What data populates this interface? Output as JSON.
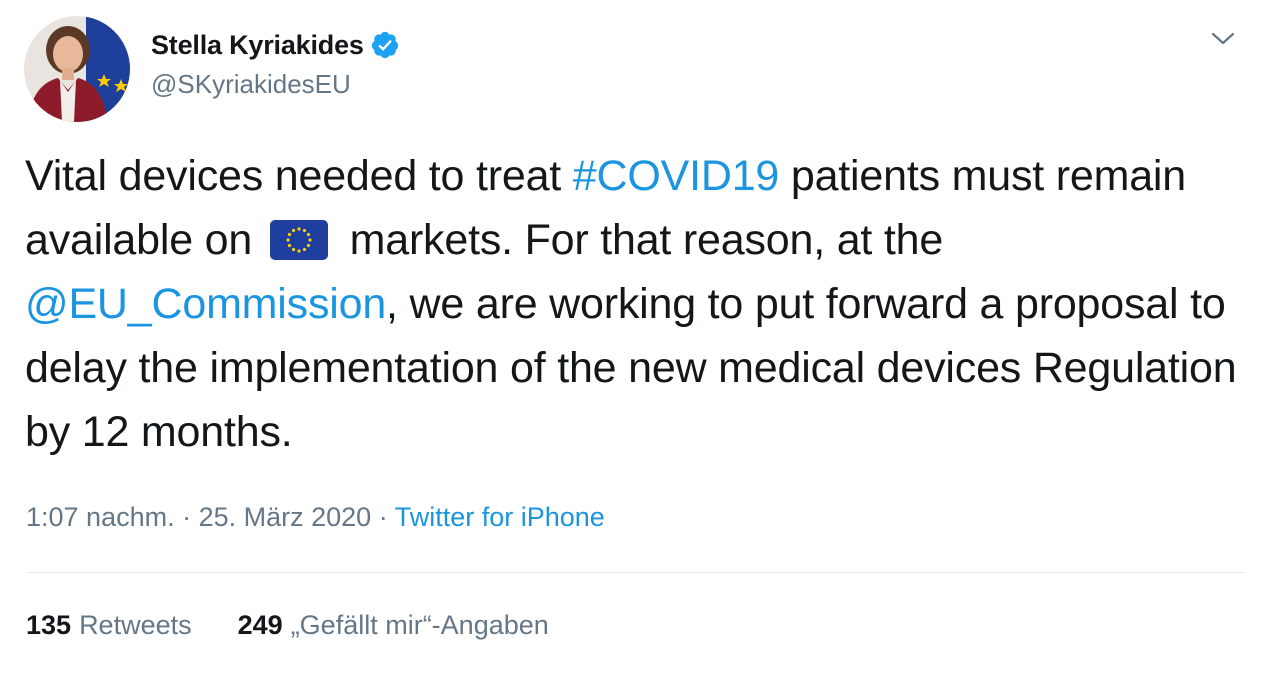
{
  "author": {
    "display_name": "Stella Kyriakides",
    "handle": "@SKyriakidesEU",
    "verified": true,
    "avatar_icon": "profile-photo"
  },
  "tweet": {
    "text_parts": {
      "p1": "Vital devices needed to treat ",
      "hashtag": "#COVID19",
      "p2": " patients must remain available on ",
      "emoji_icon": "eu-flag-emoji",
      "p3": " markets. For that reason, at the ",
      "mention": "@EU_Commission",
      "p4": ", we are working to put forward a proposal to delay the implementation of the new medical devices Regulation by 12 months."
    }
  },
  "meta": {
    "time": "1:07 nachm.",
    "separator1": " · ",
    "date": "25. März 2020",
    "separator2": " · ",
    "source": "Twitter for iPhone"
  },
  "stats": {
    "retweets_count": "135",
    "retweets_label": "Retweets",
    "likes_count": "249",
    "likes_label": "„Gefällt mir“-Angaben"
  },
  "colors": {
    "link": "#1b95e0",
    "secondary_text": "#657786",
    "primary_text": "#14171a",
    "verified_badge": "#1da1f2",
    "eu_blue": "#003399",
    "eu_star": "#ffcc00"
  }
}
